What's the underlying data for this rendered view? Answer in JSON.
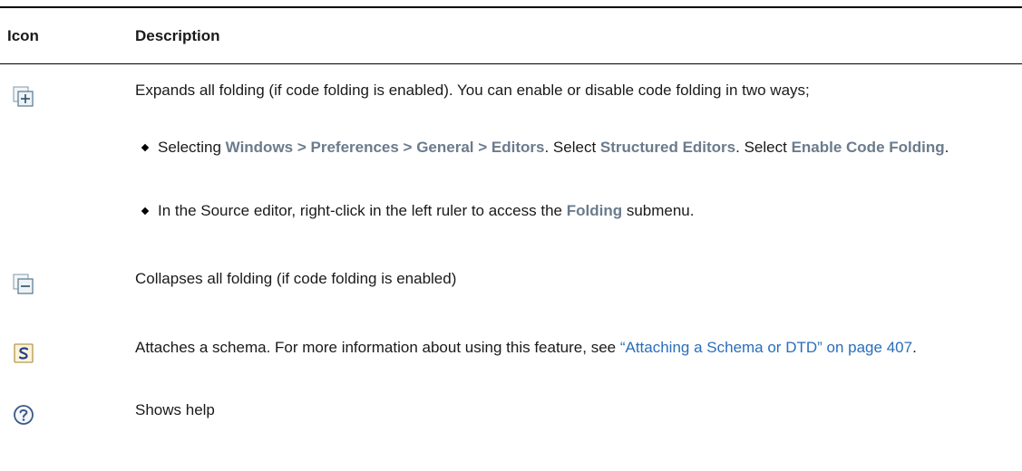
{
  "table": {
    "headers": {
      "icon": "Icon",
      "description": "Description"
    },
    "rows": [
      {
        "icon": "expand-all-icon",
        "text": "Expands all folding (if code folding is enabled). You can enable or disable code folding in two ways;",
        "bullets": [
          {
            "t1": "Selecting ",
            "b1": "Windows > Preferences > General > Editors",
            "t2": ". Select ",
            "b2": "Structured Editors",
            "t3": ". Select ",
            "b3": "Enable Code Folding",
            "t4": "."
          },
          {
            "t1": "In the Source editor, right-click in the left ruler to access the ",
            "b1": "Folding",
            "t2": " submenu."
          }
        ]
      },
      {
        "icon": "collapse-all-icon",
        "text": "Collapses all folding (if code folding is enabled)"
      },
      {
        "icon": "attach-schema-icon",
        "text": "Attaches a schema. For more information about using this feature, see ",
        "link": "“Attaching a Schema or DTD” on page 407",
        "end": "."
      },
      {
        "icon": "help-icon",
        "text": "Shows help"
      }
    ]
  }
}
